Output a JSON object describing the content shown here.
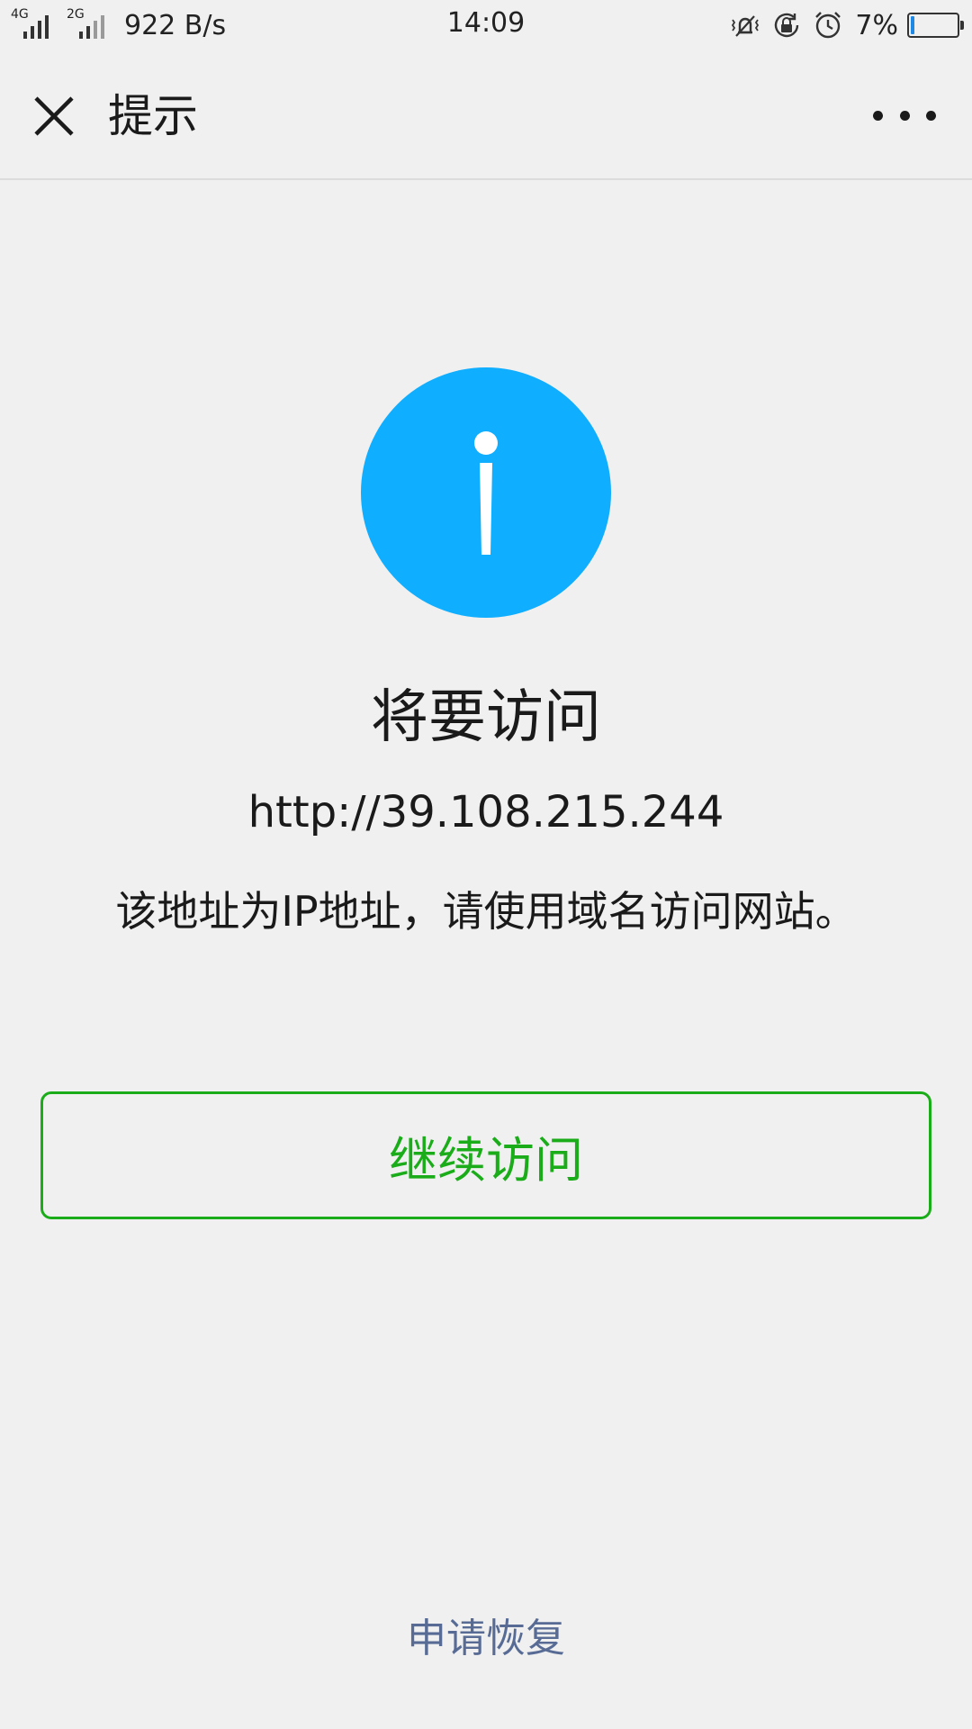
{
  "status_bar": {
    "signal1_type": "4G",
    "signal2_type": "2G",
    "net_speed": "922 B/s",
    "time": "14:09",
    "battery_text": "7%",
    "battery_level": 0.07,
    "icons": [
      "vibrate-icon",
      "rotation-lock-icon",
      "alarm-icon",
      "battery-icon"
    ]
  },
  "title_bar": {
    "close_icon": "close-icon",
    "title": "提示",
    "more_icon": "more-icon"
  },
  "main": {
    "icon": "info-icon",
    "icon_color": "#10aeff",
    "heading": "将要访问",
    "url": "http://39.108.215.244",
    "description": "该地址为IP地址，请使用域名访问网站。",
    "continue_label": "继续访问",
    "continue_color": "#1aad19",
    "restore_label": "申请恢复",
    "restore_color": "#576b95"
  }
}
